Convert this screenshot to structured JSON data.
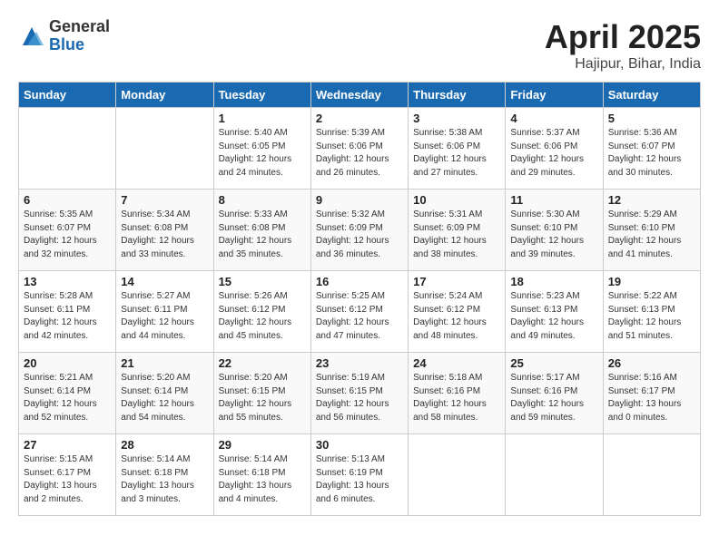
{
  "logo": {
    "general": "General",
    "blue": "Blue"
  },
  "title": "April 2025",
  "location": "Hajipur, Bihar, India",
  "days_header": [
    "Sunday",
    "Monday",
    "Tuesday",
    "Wednesday",
    "Thursday",
    "Friday",
    "Saturday"
  ],
  "weeks": [
    [
      {
        "day": "",
        "info": ""
      },
      {
        "day": "",
        "info": ""
      },
      {
        "day": "1",
        "info": "Sunrise: 5:40 AM\nSunset: 6:05 PM\nDaylight: 12 hours\nand 24 minutes."
      },
      {
        "day": "2",
        "info": "Sunrise: 5:39 AM\nSunset: 6:06 PM\nDaylight: 12 hours\nand 26 minutes."
      },
      {
        "day": "3",
        "info": "Sunrise: 5:38 AM\nSunset: 6:06 PM\nDaylight: 12 hours\nand 27 minutes."
      },
      {
        "day": "4",
        "info": "Sunrise: 5:37 AM\nSunset: 6:06 PM\nDaylight: 12 hours\nand 29 minutes."
      },
      {
        "day": "5",
        "info": "Sunrise: 5:36 AM\nSunset: 6:07 PM\nDaylight: 12 hours\nand 30 minutes."
      }
    ],
    [
      {
        "day": "6",
        "info": "Sunrise: 5:35 AM\nSunset: 6:07 PM\nDaylight: 12 hours\nand 32 minutes."
      },
      {
        "day": "7",
        "info": "Sunrise: 5:34 AM\nSunset: 6:08 PM\nDaylight: 12 hours\nand 33 minutes."
      },
      {
        "day": "8",
        "info": "Sunrise: 5:33 AM\nSunset: 6:08 PM\nDaylight: 12 hours\nand 35 minutes."
      },
      {
        "day": "9",
        "info": "Sunrise: 5:32 AM\nSunset: 6:09 PM\nDaylight: 12 hours\nand 36 minutes."
      },
      {
        "day": "10",
        "info": "Sunrise: 5:31 AM\nSunset: 6:09 PM\nDaylight: 12 hours\nand 38 minutes."
      },
      {
        "day": "11",
        "info": "Sunrise: 5:30 AM\nSunset: 6:10 PM\nDaylight: 12 hours\nand 39 minutes."
      },
      {
        "day": "12",
        "info": "Sunrise: 5:29 AM\nSunset: 6:10 PM\nDaylight: 12 hours\nand 41 minutes."
      }
    ],
    [
      {
        "day": "13",
        "info": "Sunrise: 5:28 AM\nSunset: 6:11 PM\nDaylight: 12 hours\nand 42 minutes."
      },
      {
        "day": "14",
        "info": "Sunrise: 5:27 AM\nSunset: 6:11 PM\nDaylight: 12 hours\nand 44 minutes."
      },
      {
        "day": "15",
        "info": "Sunrise: 5:26 AM\nSunset: 6:12 PM\nDaylight: 12 hours\nand 45 minutes."
      },
      {
        "day": "16",
        "info": "Sunrise: 5:25 AM\nSunset: 6:12 PM\nDaylight: 12 hours\nand 47 minutes."
      },
      {
        "day": "17",
        "info": "Sunrise: 5:24 AM\nSunset: 6:12 PM\nDaylight: 12 hours\nand 48 minutes."
      },
      {
        "day": "18",
        "info": "Sunrise: 5:23 AM\nSunset: 6:13 PM\nDaylight: 12 hours\nand 49 minutes."
      },
      {
        "day": "19",
        "info": "Sunrise: 5:22 AM\nSunset: 6:13 PM\nDaylight: 12 hours\nand 51 minutes."
      }
    ],
    [
      {
        "day": "20",
        "info": "Sunrise: 5:21 AM\nSunset: 6:14 PM\nDaylight: 12 hours\nand 52 minutes."
      },
      {
        "day": "21",
        "info": "Sunrise: 5:20 AM\nSunset: 6:14 PM\nDaylight: 12 hours\nand 54 minutes."
      },
      {
        "day": "22",
        "info": "Sunrise: 5:20 AM\nSunset: 6:15 PM\nDaylight: 12 hours\nand 55 minutes."
      },
      {
        "day": "23",
        "info": "Sunrise: 5:19 AM\nSunset: 6:15 PM\nDaylight: 12 hours\nand 56 minutes."
      },
      {
        "day": "24",
        "info": "Sunrise: 5:18 AM\nSunset: 6:16 PM\nDaylight: 12 hours\nand 58 minutes."
      },
      {
        "day": "25",
        "info": "Sunrise: 5:17 AM\nSunset: 6:16 PM\nDaylight: 12 hours\nand 59 minutes."
      },
      {
        "day": "26",
        "info": "Sunrise: 5:16 AM\nSunset: 6:17 PM\nDaylight: 13 hours\nand 0 minutes."
      }
    ],
    [
      {
        "day": "27",
        "info": "Sunrise: 5:15 AM\nSunset: 6:17 PM\nDaylight: 13 hours\nand 2 minutes."
      },
      {
        "day": "28",
        "info": "Sunrise: 5:14 AM\nSunset: 6:18 PM\nDaylight: 13 hours\nand 3 minutes."
      },
      {
        "day": "29",
        "info": "Sunrise: 5:14 AM\nSunset: 6:18 PM\nDaylight: 13 hours\nand 4 minutes."
      },
      {
        "day": "30",
        "info": "Sunrise: 5:13 AM\nSunset: 6:19 PM\nDaylight: 13 hours\nand 6 minutes."
      },
      {
        "day": "",
        "info": ""
      },
      {
        "day": "",
        "info": ""
      },
      {
        "day": "",
        "info": ""
      }
    ]
  ]
}
